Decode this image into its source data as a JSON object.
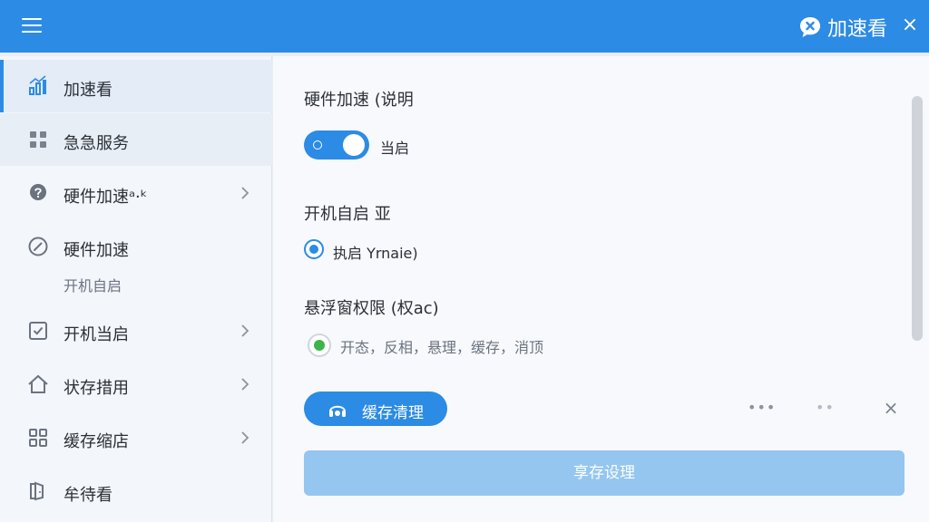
{
  "header": {
    "menu_icon": "hamburger-icon",
    "brand_icon": "chat-bubble-x-icon",
    "brand_title": "加速看",
    "close_label": "×"
  },
  "sidebar": {
    "items": [
      {
        "label": "加速看",
        "icon": "chart-bars-icon",
        "active": true
      },
      {
        "label": "急急服务",
        "icon": "grid-icon"
      },
      {
        "label": "硬件加速ᵃ·ᵏ",
        "icon": "question-circle-icon",
        "chevron": true
      },
      {
        "label": "硬件加速",
        "icon": "gauge-icon"
      },
      {
        "label": "开机当启",
        "icon": "checkbox-icon",
        "chevron": true
      },
      {
        "label": "状存措用",
        "icon": "home-icon",
        "chevron": true
      },
      {
        "label": "缓存缩店",
        "icon": "apps-grid-icon",
        "chevron": true
      },
      {
        "label": "牟待看",
        "icon": "exit-icon"
      }
    ],
    "sub_label": "开机自启"
  },
  "main": {
    "hardware_title": "硬件加速 (说明",
    "toggle_label": "当启",
    "toggle_on": true,
    "autostart_title": "开机自启 亚",
    "radio1_label": "执启 Yrnaie)",
    "float_title": "悬浮窗权限 (权ac)",
    "radio2_label": "开态，反相，悬理，缓存，消顶",
    "clean_button": "缓存清理",
    "dots_left": "•••",
    "dots_right": "••",
    "dismiss_label": "×",
    "wide_button": "享存设理"
  },
  "colors": {
    "accent": "#2c8be4",
    "wide_button": "#94c6ef",
    "radio_green": "#3cb54a"
  }
}
